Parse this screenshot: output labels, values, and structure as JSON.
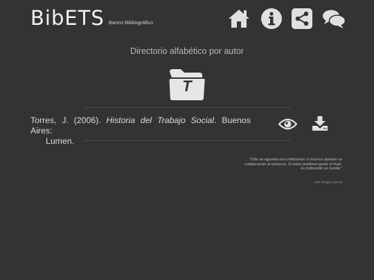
{
  "header": {
    "logo": "BibETS",
    "subtitle": "Banco Bibliográfico"
  },
  "nav": [
    {
      "name": "home",
      "icon": "home-icon"
    },
    {
      "name": "info",
      "icon": "info-icon"
    },
    {
      "name": "share",
      "icon": "share-icon"
    },
    {
      "name": "chat",
      "icon": "chat-icon"
    }
  ],
  "main": {
    "heading": "Directorio alfabético por autor",
    "letter": "T",
    "reference": {
      "authors": "Torres, J. (2006). ",
      "title": "Historia del Trabajo Social",
      "after_title": ". Buenos Aires:",
      "publisher": "Lumen."
    },
    "actions": [
      {
        "name": "view",
        "icon": "eye-icon"
      },
      {
        "name": "download",
        "icon": "download-icon"
      }
    ]
  },
  "quote": {
    "text": "\"Sólo se aguanta una civilización si muchos aportan su colaboración al esfuerzo. Si todos prefieren gozar el fruto, la civilización se hunde.\"",
    "author": "José Ortega y Gasset"
  },
  "colors": {
    "background": "#333333",
    "icon": "#e0e0e0",
    "folder": "#e6e6e6"
  }
}
